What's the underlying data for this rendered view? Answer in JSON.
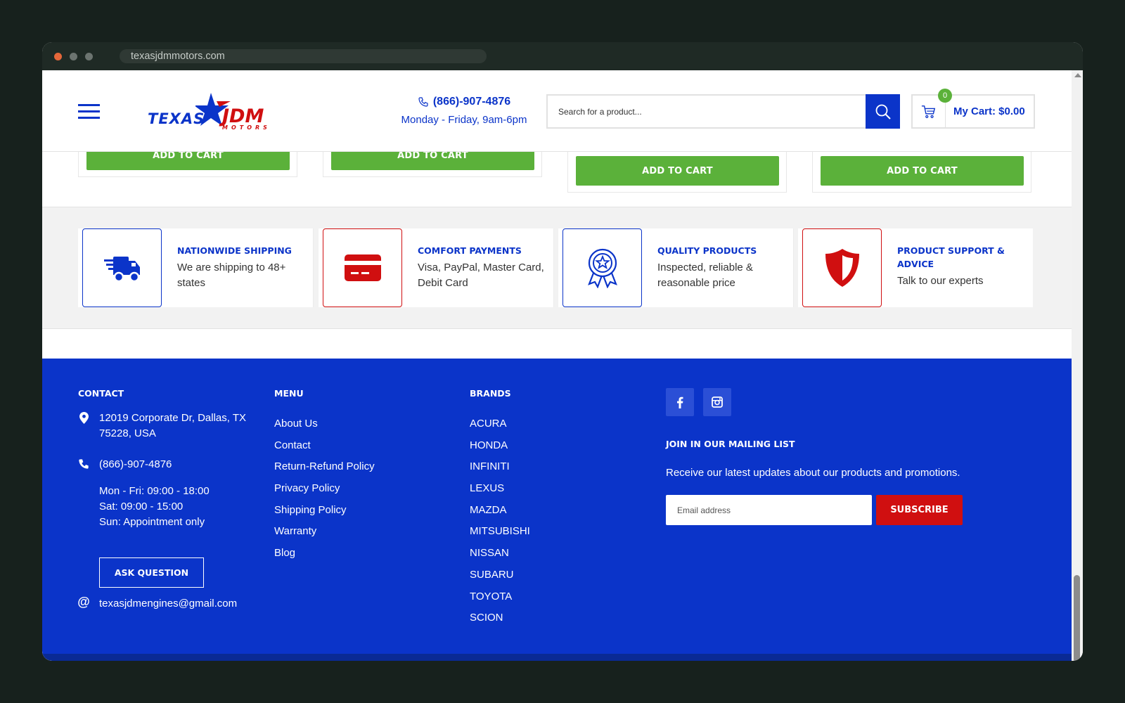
{
  "browser": {
    "url": "texasjdmmotors.com"
  },
  "header": {
    "logo": {
      "text_main": "TEXAS",
      "text_accent": "JDM",
      "text_sub": "MOTORS"
    },
    "phone": "(866)-907-4876",
    "hours": "Monday - Friday, 9am-6pm",
    "search_placeholder": "Search for a product...",
    "cart_count": "0",
    "cart_label": "My Cart: $0.00"
  },
  "products": {
    "add_to_cart_label": "ADD TO CART"
  },
  "features": [
    {
      "icon": "truck-icon",
      "title": "NATIONWIDE SHIPPING",
      "text": "We are shipping to 48+ states",
      "color": "#0b34c9"
    },
    {
      "icon": "credit-card-icon",
      "title": "COMFORT PAYMENTS",
      "text": "Visa, PayPal, Master Card, Debit Card",
      "color": "#d00f10"
    },
    {
      "icon": "award-ribbon-icon",
      "title": "QUALITY PRODUCTS",
      "text": "Inspected, reliable & reasonable price",
      "color": "#0b34c9"
    },
    {
      "icon": "shield-icon",
      "title": "PRODUCT SUPPORT & ADVICE",
      "text": "Talk to our experts",
      "color": "#d00f10"
    }
  ],
  "footer": {
    "contact": {
      "title": "CONTACT",
      "address": "12019 Corporate Dr, Dallas, TX 75228, USA",
      "phone": "(866)-907-4876",
      "hours": [
        "Mon - Fri: 09:00 - 18:00",
        "Sat: 09:00 - 15:00",
        "Sun: Appointment only"
      ],
      "ask_label": "ASK QUESTION",
      "email": "texasjdmengines@gmail.com"
    },
    "menu": {
      "title": "MENU",
      "items": [
        "About Us",
        "Contact",
        "Return-Refund Policy",
        "Privacy Policy",
        "Shipping Policy",
        "Warranty",
        "Blog"
      ]
    },
    "brands": {
      "title": "BRANDS",
      "items": [
        "ACURA",
        "HONDA",
        "INFINITI",
        "LEXUS",
        "MAZDA",
        "MITSUBISHI",
        "NISSAN",
        "SUBARU",
        "TOYOTA",
        "SCION"
      ]
    },
    "social": [
      "facebook-icon",
      "instagram-icon"
    ],
    "mailing": {
      "title": "JOIN IN OUR MAILING LIST",
      "text": "Receive our latest updates about our products and promotions.",
      "placeholder": "Email address",
      "subscribe_label": "SUBSCRIBE"
    }
  },
  "colors": {
    "brand_blue": "#0b34c9",
    "brand_red": "#d00f10",
    "cart_green": "#5bb13a"
  }
}
